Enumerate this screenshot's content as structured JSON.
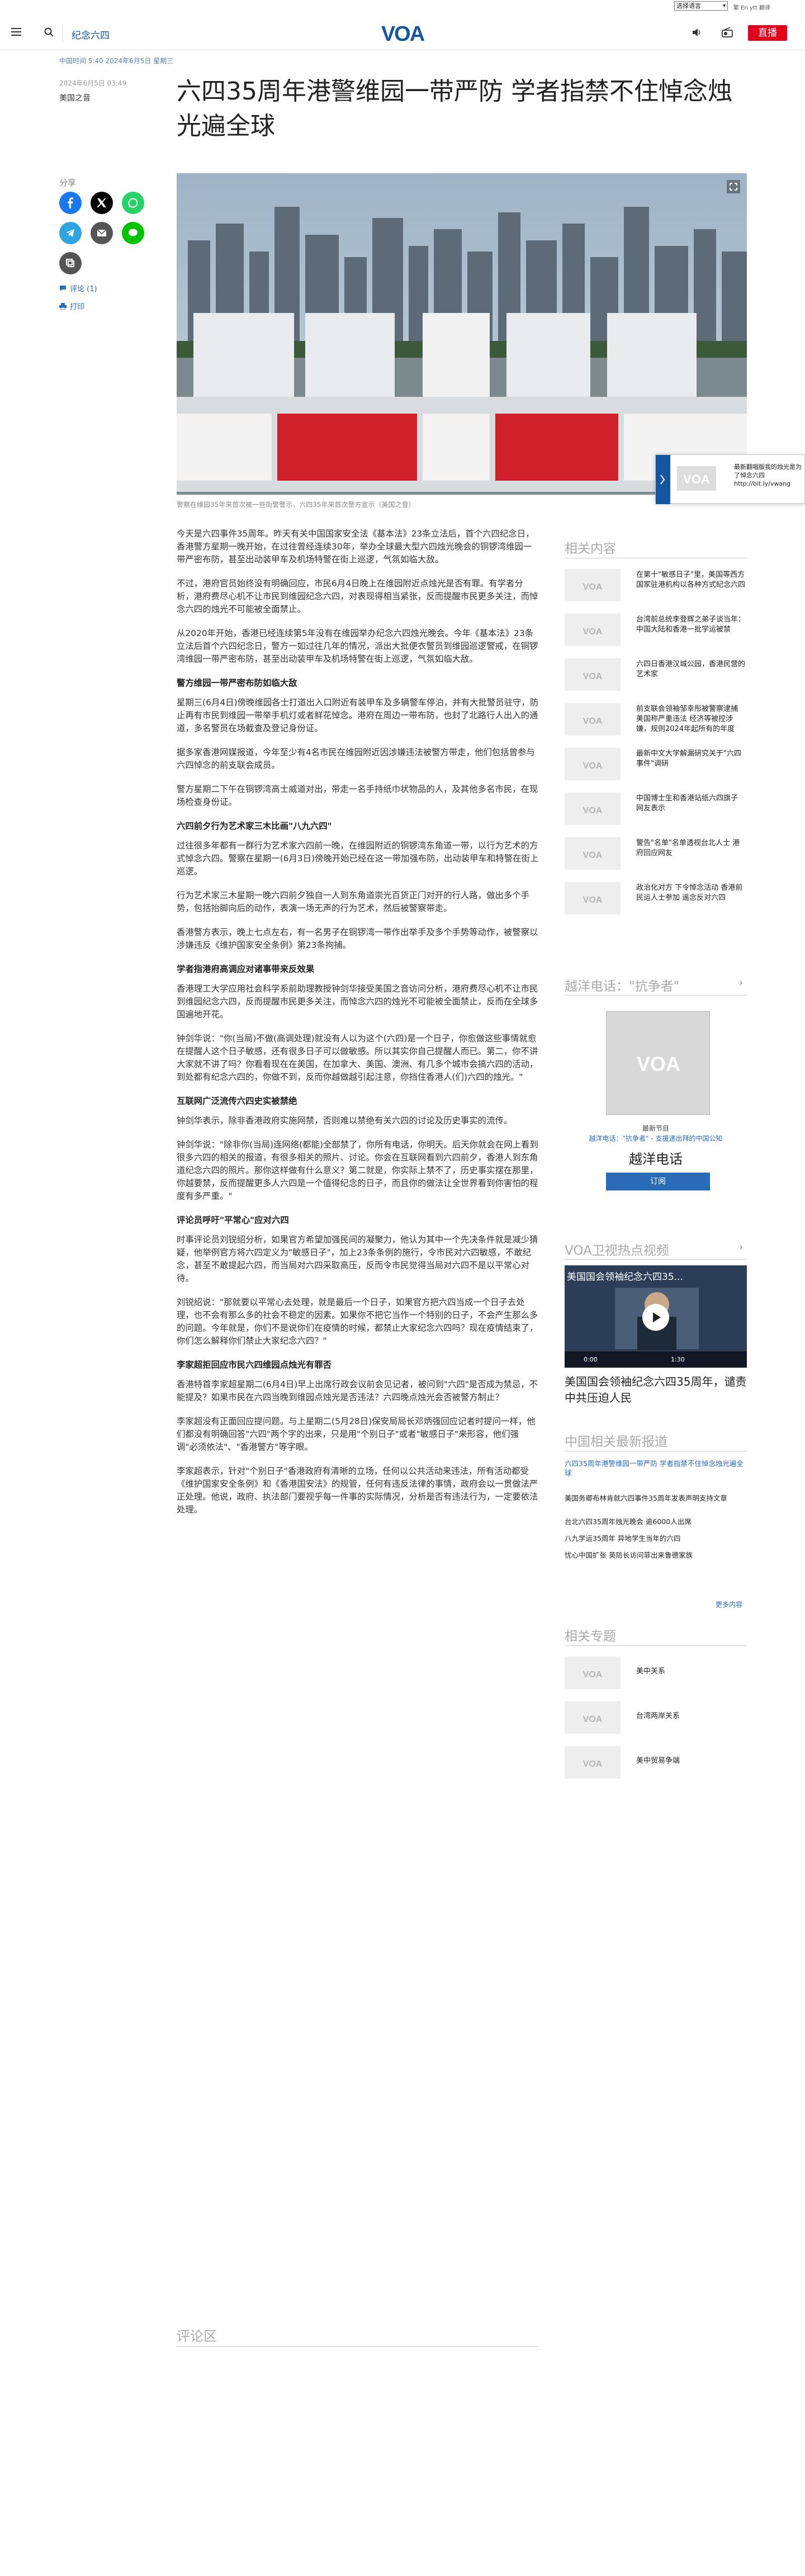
{
  "topbar": {
    "language": "选择语言",
    "links": "繁 En ytt 翻译",
    "links_bold": "翻译"
  },
  "header": {
    "section": "纪念六四",
    "logo": "VOA",
    "live": "直播"
  },
  "article": {
    "date_strip": "中国时间 5:40 2024年6月5日 星期三",
    "published": "2024年6月5日 03:49",
    "author": "美国之音",
    "title": "六四35周年港警维园一带严防 学者指禁不住悼念烛光遍全球",
    "caption": "警察在维园35年来首次被一些街警警示，六四35年来首次警方宣示（美国之音）",
    "paragraphs": [
      {
        "type": "p",
        "text": "今天是六四事件35周年。昨天有关中国国家安全法《基本法》23条立法后，首个六四纪念日，香港警方星期一晚开始，在过往曾经连续30年，举办全球最大型六四烛光晚会的铜锣湾维园一带严密布防，甚至出动装甲车及机场特警在街上巡逻，气氛如临大敌。"
      },
      {
        "type": "p",
        "text": "不过，港府官员始终没有明确回应，市民6月4日晚上在维园附近点烛光是否有罪。有学者分析，港府费尽心机不让市民到维园纪念六四，对表现得相当紧张，反而提醒市民更多关注，而悼念六四的烛光不可能被全面禁止。"
      },
      {
        "type": "p",
        "text": "从2020年开始，香港已经连续第5年没有在维园举办纪念六四烛光晚会。今年《基本法》23条立法后首个六四纪念日，警方一如过往几年的情况，派出大批便衣警员到维园巡逻警戒，在铜锣湾维园一带严密布防，甚至出动装甲车及机场特警在街上巡逻，气氛如临大敌。"
      },
      {
        "type": "h",
        "text": "警方维园一带严密布防如临大敌"
      },
      {
        "type": "p",
        "text": "星期三(6月4日)傍晚维园各士打道出入口附近有装甲车及多辆警车停泊，并有大批警员驻守，防止再有市民到维园一带举手机灯或者鲜花悼念。港府在周边一带布防，也封了北路行人出入的通道，多名警员在场截查及登记身份证。"
      },
      {
        "type": "p",
        "text": "据多家香港网媒报道，今年至少有4名市民在维园附近因涉嫌违法被警方带走，他们包括曾参与六四悼念的前支联会成员。"
      },
      {
        "type": "p",
        "text": "警方星期二下午在铜锣湾高士威道对出，带走一名手持纸巾状物品的人，及其他多名市民，在现场检查身份证。"
      },
      {
        "type": "h",
        "text": "六四前夕行为艺术家三木比画\"八九六四\""
      },
      {
        "type": "p",
        "text": "过往很多年都有一群行为艺术家六四前一晚，在维园附近的铜锣湾东角道一带，以行为艺术的方式悼念六四。警察在星期一(6月3日)傍晚开始已经在这一带加强布防，出动装甲车和特警在街上巡逻。"
      },
      {
        "type": "p",
        "text": "行为艺术家三木星期一晚六四前夕独自一人到东角道崇光百货正门对开的行人路，做出多个手势，包括抬脚向后的动作，表演一场无声的行为艺术，然后被警察带走。"
      },
      {
        "type": "p",
        "text": "香港警方表示，晚上七点左右，有一名男子在铜锣湾一带作出举手及多个手势等动作，被警察以涉嫌违反《维护国家安全条例》第23条拘捕。"
      },
      {
        "type": "h",
        "text": "学者指港府高调应对诸事带来反效果"
      },
      {
        "type": "p",
        "text": "香港理工大学应用社会科学系前助理教授钟剑华接受美国之音访问分析，港府费尽心机不让市民到维园纪念六四，反而提醒市民更多关注，而悼念六四的烛光不可能被全面禁止，反而在全球多国遍地开花。"
      },
      {
        "type": "p",
        "text": "钟剑华说：\"你(当局)不做(高调处理)就没有人以为这个(六四)是一个日子，你愈做这些事情就愈在提醒人这个日子敏感，还有很多日子可以做敏感。所以其实你自己提醒人而已。第二，你不讲大家就不讲了吗？你看看现在在美国，在加拿大、美国、澳洲、有几多个城市会搞六四的活动，到处都有纪念六四的，你做不到，反而你越做越引起注意，你挡住香港人(们)六四的烛光。\""
      },
      {
        "type": "h",
        "text": "互联网广泛流传六四史实被禁绝"
      },
      {
        "type": "p",
        "text": "钟剑华表示，除非香港政府实施网禁，否则难以禁绝有关六四的讨论及历史事实的流传。"
      },
      {
        "type": "p",
        "text": "钟剑华说：\"除非你(当局)连网络(都能)全部禁了，你所有电话，你明天。后天你就会在网上看到很多六四的相关的报道，有很多相关的照片、讨论。你会在互联网看到六四前夕，香港人到东角道纪念六四的照片。那你这样做有什么意义？第二就是，你实际上禁不了，历史事实摆在那里，你越要禁，反而提醒更多人六四是一个值得纪念的日子，而且你的做法让全世界看到你害怕的程度有多严重。\""
      },
      {
        "type": "h",
        "text": "评论员呼吁\"平常心\"应对六四"
      },
      {
        "type": "p",
        "text": "时事评论员刘锐绍分析，如果官方希望加强民间的凝聚力，他认为其中一个先决条件就是减少猜疑，他举例官方将六四定义为\"敏感日子\"，加上23条条例的施行，令市民对六四敏感，不敢纪念，甚至不敢提起六四，而当局对六四采取高压，反而令市民觉得当局对六四不是以平常心对待。"
      },
      {
        "type": "p",
        "text": "刘锐绍说：\"那就要以平常心去处理，就是最后一个日子，如果官方把六四当成一个日子去处理，也不会有那么多的社会不稳定的因素。如果你不把它当作一个特别的日子，不会产生那么多的问题。今年就是，你们不是说你们在疫情的时候，都禁止大家纪念六四吗？现在疫情结束了，你们怎么解释你们禁止大家纪念六四？\""
      },
      {
        "type": "h",
        "text": "李家超拒回应市民六四维园点烛光有罪否"
      },
      {
        "type": "p",
        "text": "香港特首李家超星期二(6月4日)早上出席行政会议前会见记者，被问到\"六四\"是否成为禁忌，不能提及？如果市民在六四当晚到维园点烛光是否违法？六四晚点烛光会否被警方制止？"
      },
      {
        "type": "p",
        "text": "李家超没有正面回应提问题。与上星期二(5月28日)保安局局长邓炳强回应记者时提问一样，他们都没有明确回答\"六四\"两个字的出来，只是用\"个别日子\"或者\"敏感日子\"来形容，他们强调\"必须依法\"、\"香港警方\"等字眼。"
      },
      {
        "type": "p",
        "text": "李家超表示，针对\"个别日子\"香港政府有清晰的立场，任何以公共活动来违法，所有活动都受《维护国家安全条例》和《香港国安法》的规管，任何有违反法律的事情，政府会以一贯做法严正处理。他说，政府、执法部门要视乎每一件事的实际情况，分析是否有违法行为，一定要依法处理。"
      }
    ],
    "comments_heading": "评论区"
  },
  "share": {
    "label": "分享",
    "comments_link": "评论 (1)",
    "print_link": "打印"
  },
  "sidebar": {
    "related_heading": "相关内容",
    "related": [
      "在第十\"敏感日子\"里，美国等西方国家驻港机构以各种方式纪念六四",
      "台湾前总统李登辉之弟子谈当年：中国大陆和香港一批学运被禁",
      "六四日香港汉城公园，香港民营的艺术家",
      "前支联会领袖邹幸彤被警察逮捕 美国称严重违法 经济等被控涉嫌，规则2024年起所有的年度",
      "最新中文大学解漏研究关于\"六四事件\"调研",
      "中国博士生和香港站纸六四旗子 网友表示",
      "警告\"名单\"名单透视台北人士 港府回应网友",
      "政治化对方 下令悼念活动 香港前民运人士参加 遥念反对六四"
    ],
    "hotline_heading": "越洋电话：\"抗争者\"",
    "hotline_ep_label": "最新节目",
    "hotline_ep_sub": "越洋电话：\"抗争者\" - 支援递出拜的中国公知",
    "hotline_title": "越洋电话",
    "subscribe": "订阅",
    "video_heading": "VOA卫视热点视频",
    "video_title": "美国国会领袖纪念六四35...",
    "video_time": "0:00",
    "video_time_end": "1:30",
    "video_caption": "美国国会领袖纪念六四35周年，谴责中共压迫人民",
    "more_heading": "中国相关最新报道",
    "more_items": [
      "六四35周年港警维园一带严防 学者指禁不住悼念烛光遍全球",
      "美国务卿布林肯就六四事件35周年发表声明支持文章",
      "台北六四35周年烛光晚会 逾6000人出席",
      "八九学运35周年 异地学生当年的六四",
      "忧心中国扩张 英防长访问菲出来鲁德家族"
    ],
    "more_link": "更多内容",
    "topics_heading": "相关专题",
    "topics": [
      "美中关系",
      "台湾两岸关系",
      "美中贸易争端"
    ]
  },
  "toast": {
    "text": "最新翻唱版我的烛光是为了悼念六四 http://bit.ly/vwang"
  },
  "colors": {
    "brand_blue": "#1456a0",
    "live_red": "#e2001a",
    "link_blue": "#2a6bb8"
  }
}
